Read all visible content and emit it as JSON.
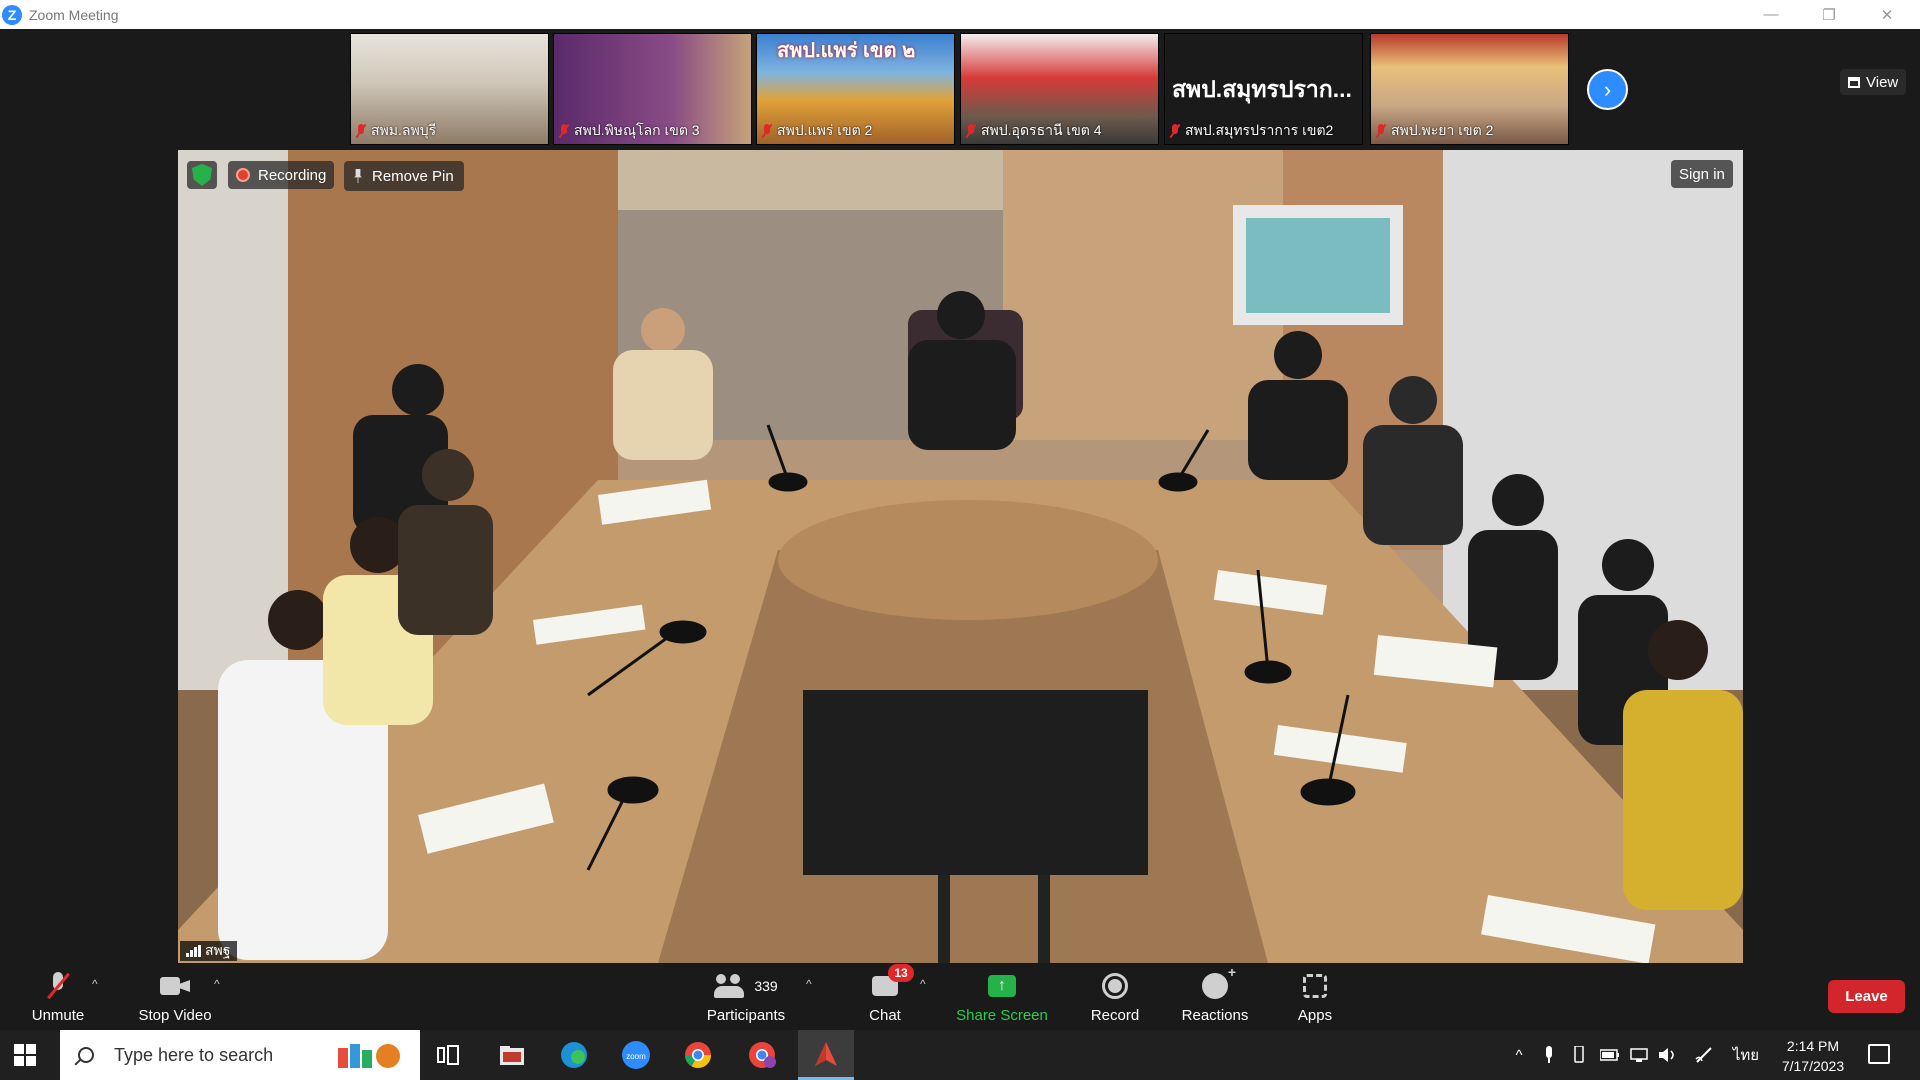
{
  "window": {
    "title": "Zoom Meeting",
    "logo_letter": "Z",
    "controls": {
      "minimize": "—",
      "restore": "❐",
      "close": "✕"
    }
  },
  "strip": {
    "thumbnails": [
      {
        "name": "สพม.ลพบุรี",
        "muted": true
      },
      {
        "name": "สพป.พิษณุโลก เขต 3",
        "muted": true
      },
      {
        "name": "สพป.แพร่ เขต 2",
        "muted": true,
        "overlay_text": "สพป.แพร่ เขต ๒"
      },
      {
        "name": "สพป.อุดรธานี เขต 4",
        "muted": true
      },
      {
        "name": "สพป.สมุทรปราการ เขต2",
        "muted": true,
        "big_name": "สพป.สมุทรปราก..."
      },
      {
        "name": "สพป.พะยา เขต 2",
        "muted": true
      }
    ],
    "next_icon": "›",
    "view_label": "View"
  },
  "main_video": {
    "recording_label": "Recording",
    "remove_pin_label": "Remove Pin",
    "sign_in_label": "Sign in",
    "participant_name": "สพฐ",
    "colors": {
      "wall": "#b4977a",
      "table": "#c49b6c",
      "floor": "#8a6a4c"
    }
  },
  "toolbar": {
    "unmute": "Unmute",
    "stop_video": "Stop Video",
    "participants": "Participants",
    "participants_count": "339",
    "chat": "Chat",
    "chat_badge": "13",
    "share_screen": "Share Screen",
    "record": "Record",
    "reactions": "Reactions",
    "apps": "Apps",
    "leave": "Leave",
    "caret": "^",
    "share_arrow": "↑"
  },
  "taskbar": {
    "search_placeholder": "Type here to search",
    "language": "ไทย",
    "time": "2:14 PM",
    "date": "7/17/2023",
    "tray_chevron": "^"
  }
}
